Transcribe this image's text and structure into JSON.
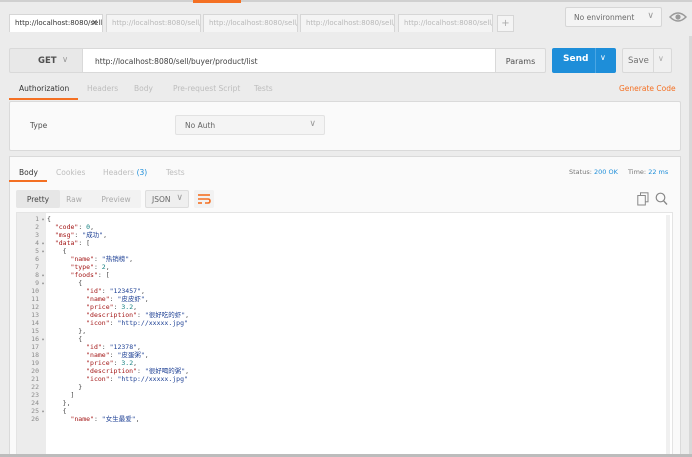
{
  "tabs": [
    {
      "label": "http://localhost:8080/sell/",
      "active": true
    },
    {
      "label": "http://localhost:8080/sell/l",
      "active": false
    },
    {
      "label": "http://localhost:8080/sell/l",
      "active": false
    },
    {
      "label": "http://localhost:8080/sell/l",
      "active": false
    },
    {
      "label": "http://localhost:8080/sell/l",
      "active": false
    }
  ],
  "new_tab": "+",
  "environment": "No environment",
  "request": {
    "method": "GET",
    "url": "http://localhost:8080/sell/buyer/product/list",
    "params_label": "Params",
    "send_label": "Send",
    "save_label": "Save"
  },
  "request_tabs": [
    "Authorization",
    "Headers",
    "Body",
    "Pre-request Script",
    "Tests"
  ],
  "generate_code": "Generate Code",
  "auth": {
    "type_label": "Type",
    "type_value": "No Auth"
  },
  "response": {
    "tabs": {
      "body": "Body",
      "cookies": "Cookies",
      "headers": "Headers",
      "headers_count": "(3)",
      "tests": "Tests"
    },
    "status_label": "Status:",
    "status_value": "200 OK",
    "time_label": "Time:",
    "time_value": "22 ms",
    "view_modes": [
      "Pretty",
      "Raw",
      "Preview"
    ],
    "format": "JSON"
  },
  "code_lines": [
    {
      "n": "1",
      "fold": true,
      "t": "{"
    },
    {
      "n": "2",
      "fold": false,
      "t": "  \"code\": 0,"
    },
    {
      "n": "3",
      "fold": false,
      "t": "  \"msg\": \"成功\","
    },
    {
      "n": "4",
      "fold": true,
      "t": "  \"data\": ["
    },
    {
      "n": "5",
      "fold": true,
      "t": "    {"
    },
    {
      "n": "6",
      "fold": false,
      "t": "      \"name\": \"热销榜\","
    },
    {
      "n": "7",
      "fold": false,
      "t": "      \"type\": 2,"
    },
    {
      "n": "8",
      "fold": true,
      "t": "      \"foods\": ["
    },
    {
      "n": "9",
      "fold": true,
      "t": "        {"
    },
    {
      "n": "10",
      "fold": false,
      "t": "          \"id\": \"123457\","
    },
    {
      "n": "11",
      "fold": false,
      "t": "          \"name\": \"皮皮虾\","
    },
    {
      "n": "12",
      "fold": false,
      "t": "          \"price\": 3.2,"
    },
    {
      "n": "13",
      "fold": false,
      "t": "          \"description\": \"很好吃的虾\","
    },
    {
      "n": "14",
      "fold": false,
      "t": "          \"icon\": \"http://xxxxx.jpg\""
    },
    {
      "n": "15",
      "fold": false,
      "t": "        },"
    },
    {
      "n": "16",
      "fold": true,
      "t": "        {"
    },
    {
      "n": "17",
      "fold": false,
      "t": "          \"id\": \"12378\","
    },
    {
      "n": "18",
      "fold": false,
      "t": "          \"name\": \"皮蛋粥\","
    },
    {
      "n": "19",
      "fold": false,
      "t": "          \"price\": 3.2,"
    },
    {
      "n": "20",
      "fold": false,
      "t": "          \"description\": \"很好喝的粥\","
    },
    {
      "n": "21",
      "fold": false,
      "t": "          \"icon\": \"http://xxxxx.jpg\""
    },
    {
      "n": "22",
      "fold": false,
      "t": "        }"
    },
    {
      "n": "23",
      "fold": false,
      "t": "      ]"
    },
    {
      "n": "24",
      "fold": false,
      "t": "    },"
    },
    {
      "n": "25",
      "fold": true,
      "t": "    {"
    },
    {
      "n": "26",
      "fold": false,
      "t": "      \"name\": \"女生最爱\","
    }
  ],
  "icons": {
    "close": "close-icon",
    "environment_eye": "eye-icon",
    "wrap": "wrap-lines-icon",
    "copy": "copy-icon",
    "search": "search-icon"
  },
  "colors": {
    "accent": "#f47023",
    "send": "#1e8ed9",
    "status_ok": "#1e8ed9"
  }
}
